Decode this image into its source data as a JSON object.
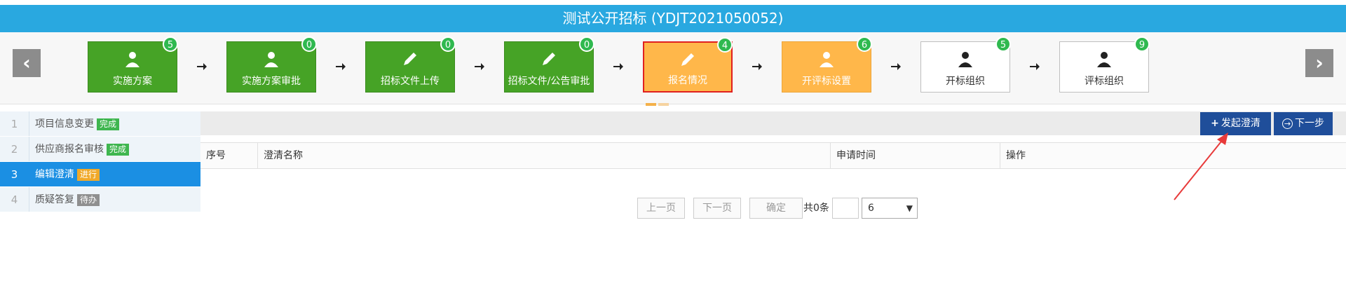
{
  "header": {
    "title": "测试公开招标 (YDJT2021050052)"
  },
  "nav": {
    "prev_icon": "‹",
    "next_icon": "›"
  },
  "steps": [
    {
      "label": "实施方案",
      "count": "5",
      "icon": "person-icon",
      "style": "green"
    },
    {
      "label": "实施方案审批",
      "count": "0",
      "icon": "person-icon",
      "style": "green"
    },
    {
      "label": "招标文件上传",
      "count": "0",
      "icon": "pencil-icon",
      "style": "green"
    },
    {
      "label": "招标文件/公告审批",
      "count": "0",
      "icon": "pencil-icon",
      "style": "green"
    },
    {
      "label": "报名情况",
      "count": "4",
      "icon": "pencil-icon",
      "style": "orange-active"
    },
    {
      "label": "开评标设置",
      "count": "6",
      "icon": "person-icon",
      "style": "orange"
    },
    {
      "label": "开标组织",
      "count": "5",
      "icon": "person-icon",
      "style": "white"
    },
    {
      "label": "评标组织",
      "count": "9",
      "icon": "person-icon",
      "style": "white"
    }
  ],
  "sidebar": {
    "items": [
      {
        "num": "1",
        "label": "项目信息变更",
        "tag": "完成",
        "tag_color": "#3fb64f"
      },
      {
        "num": "2",
        "label": "供应商报名审核",
        "tag": "完成",
        "tag_color": "#3fb64f"
      },
      {
        "num": "3",
        "label": "编辑澄清",
        "tag": "进行",
        "tag_color": "#f0a92a"
      },
      {
        "num": "4",
        "label": "质疑答复",
        "tag": "待办",
        "tag_color": "#8f8f8f"
      }
    ]
  },
  "toolbar": {
    "launch_label": "发起澄清",
    "launch_icon": "+",
    "next_label": "下一步",
    "next_icon": "→"
  },
  "table": {
    "columns": [
      "序号",
      "澄清名称",
      "申请时间",
      "操作"
    ],
    "rows": []
  },
  "pagination": {
    "prev_label": "上一页",
    "next_label": "下一页",
    "confirm_label": "确定",
    "total_text": "共0条",
    "page_input": "",
    "page_size": "6"
  },
  "colors": {
    "header_bg": "#29a8e0",
    "green": "#46a326",
    "orange": "#ffb74a",
    "primary_btn": "#1f4e9a",
    "active_side": "#1b8fe3"
  }
}
